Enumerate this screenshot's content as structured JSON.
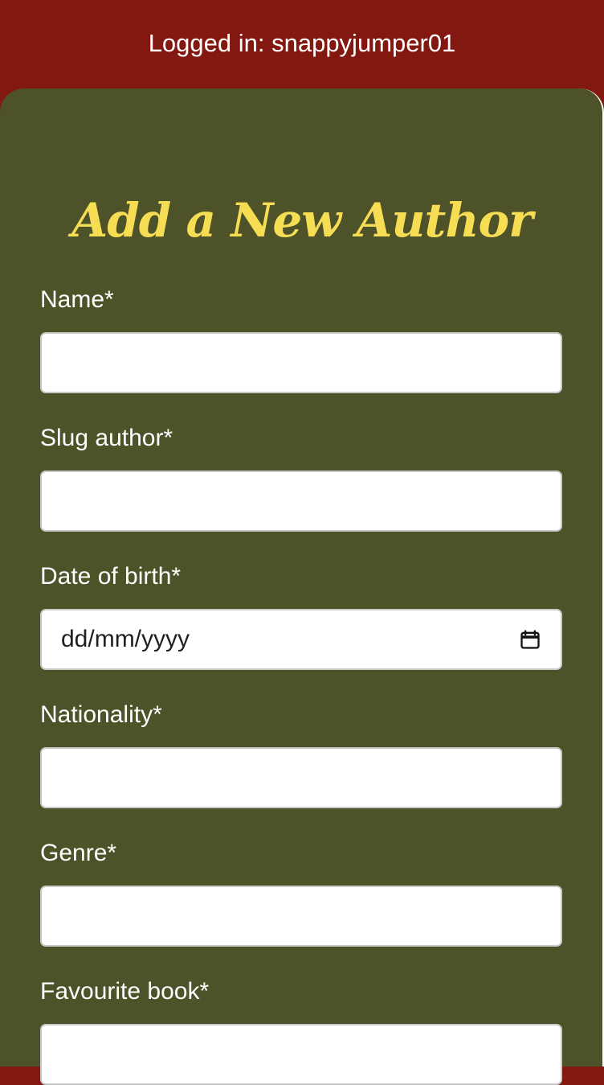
{
  "header": {
    "login_status": "Logged in: snappyjumper01"
  },
  "form": {
    "title": "Add a New Author",
    "fields": [
      {
        "label": "Name*",
        "value": "",
        "placeholder": ""
      },
      {
        "label": "Slug author*",
        "value": "",
        "placeholder": ""
      },
      {
        "label": "Date of birth*",
        "value": "",
        "placeholder": "dd/mm/yyyy",
        "icon": "calendar-icon"
      },
      {
        "label": "Nationality*",
        "value": "",
        "placeholder": ""
      },
      {
        "label": "Genre*",
        "value": "",
        "placeholder": ""
      },
      {
        "label": "Favourite book*",
        "value": "",
        "placeholder": ""
      }
    ]
  },
  "colors": {
    "header_bg": "#82180f",
    "card_bg": "#4e5228",
    "title": "#f7dd54",
    "label": "#ffffff",
    "input_bg": "#ffffff",
    "input_border": "#c8c8c8"
  }
}
